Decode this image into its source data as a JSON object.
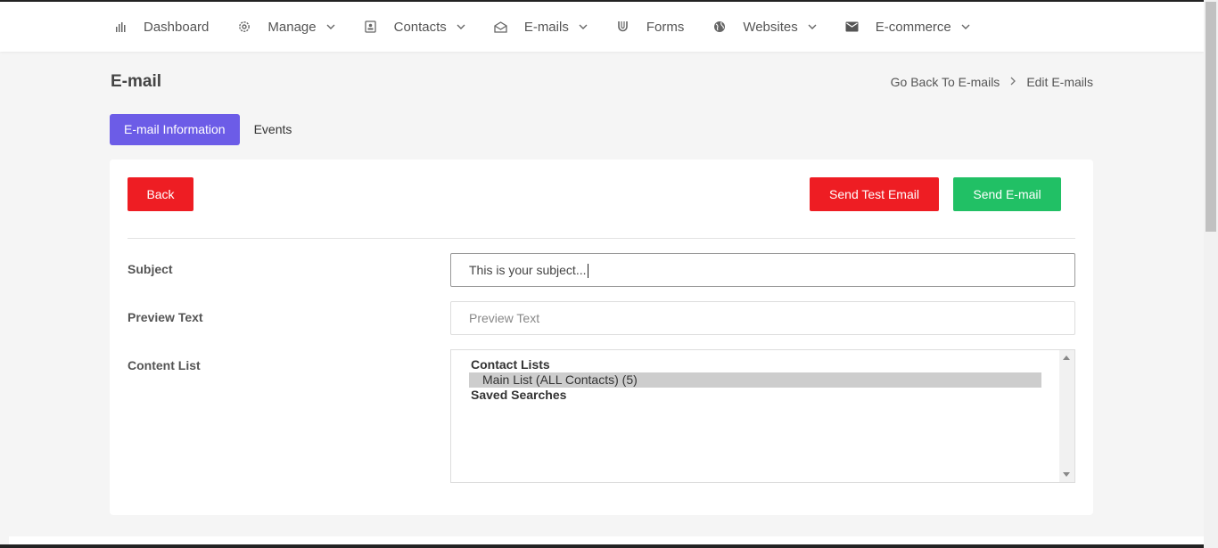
{
  "nav": {
    "items": [
      {
        "label": "Dashboard",
        "icon": "bar-chart-icon",
        "has_dropdown": false
      },
      {
        "label": "Manage",
        "icon": "gear-icon",
        "has_dropdown": true
      },
      {
        "label": "Contacts",
        "icon": "contact-card-icon",
        "has_dropdown": true
      },
      {
        "label": "E-mails",
        "icon": "envelope-open-icon",
        "has_dropdown": true
      },
      {
        "label": "Forms",
        "icon": "magnet-icon",
        "has_dropdown": false
      },
      {
        "label": "Websites",
        "icon": "globe-icon",
        "has_dropdown": true
      },
      {
        "label": "E-commerce",
        "icon": "mail-box-icon",
        "has_dropdown": true
      }
    ]
  },
  "page": {
    "title": "E-mail",
    "breadcrumb": {
      "back_link": "Go Back To E-mails",
      "current": "Edit E-mails"
    }
  },
  "tabs": [
    {
      "label": "E-mail Information",
      "active": true
    },
    {
      "label": "Events",
      "active": false
    }
  ],
  "actions": {
    "back": "Back",
    "send_test": "Send Test Email",
    "send": "Send E-mail"
  },
  "form": {
    "subject": {
      "label": "Subject",
      "value": "This is your subject..."
    },
    "preview_text": {
      "label": "Preview Text",
      "placeholder": "Preview Text"
    },
    "content_list": {
      "label": "Content List",
      "groups": [
        {
          "label": "Contact Lists",
          "options": [
            "Main List (ALL Contacts) (5)"
          ]
        },
        {
          "label": "Saved Searches",
          "options": []
        }
      ],
      "selected": "Main List (ALL Contacts) (5)"
    }
  },
  "colors": {
    "accent": "#6c5ce7",
    "danger": "#ee1d23",
    "success": "#21c065"
  }
}
